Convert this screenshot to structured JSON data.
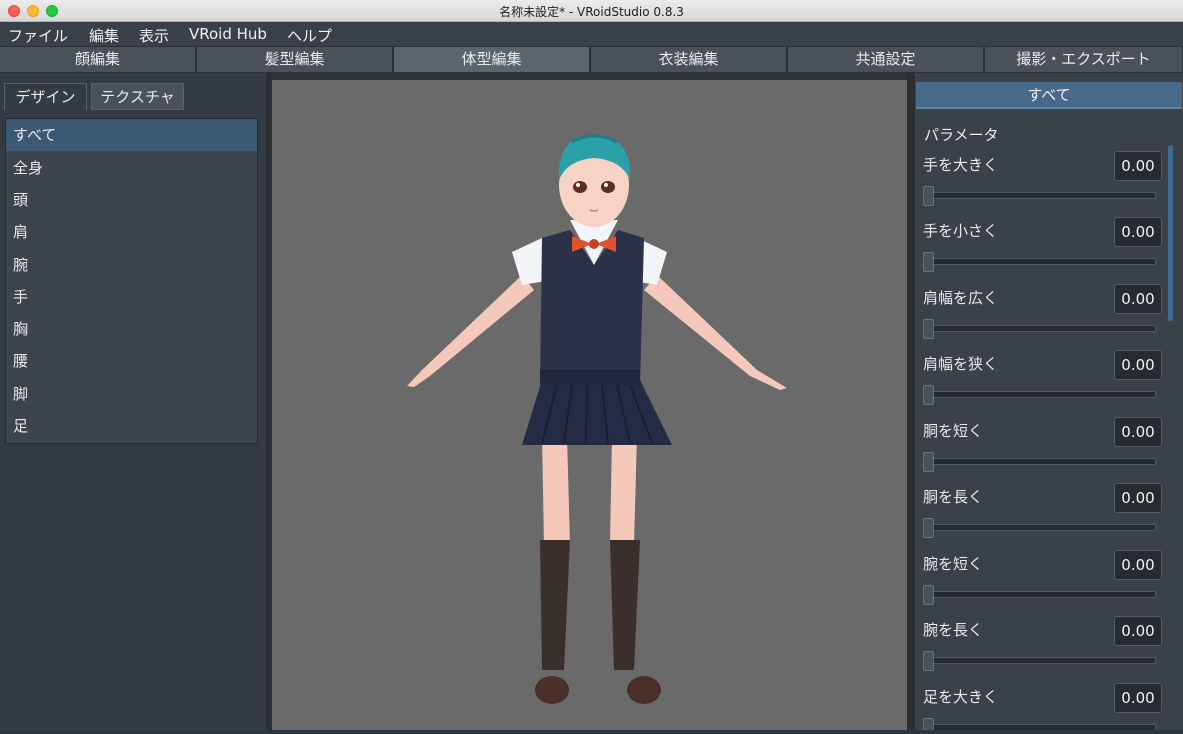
{
  "window": {
    "title": "名称未設定* - VRoidStudio 0.8.3"
  },
  "menu": [
    "ファイル",
    "編集",
    "表示",
    "VRoid Hub",
    "ヘルプ"
  ],
  "main_tabs": [
    "顔編集",
    "髪型編集",
    "体型編集",
    "衣装編集",
    "共通設定",
    "撮影・エクスポート"
  ],
  "active_main_tab": "体型編集",
  "left_panel": {
    "tabs": [
      "デザイン",
      "テクスチャ"
    ],
    "active_tab": "デザイン",
    "items": [
      "すべて",
      "全身",
      "頭",
      "肩",
      "腕",
      "手",
      "胸",
      "腰",
      "脚",
      "足"
    ],
    "selected_item": "すべて"
  },
  "right_panel": {
    "tab": "すべて",
    "section_title": "パラメータ",
    "params": [
      {
        "label": "手を大きく",
        "value": "0.00",
        "level": 0
      },
      {
        "label": "手を小さく",
        "value": "0.00",
        "level": 0
      },
      {
        "label": "肩幅を広く",
        "value": "0.00",
        "level": 0
      },
      {
        "label": "肩幅を狭く",
        "value": "0.00",
        "level": 0
      },
      {
        "label": "胴を短く",
        "value": "0.00",
        "level": 0
      },
      {
        "label": "胴を長く",
        "value": "0.00",
        "level": 0
      },
      {
        "label": "腕を短く",
        "value": "0.00",
        "level": 0
      },
      {
        "label": "腕を長く",
        "value": "0.00",
        "level": 0
      },
      {
        "label": "足を大きく",
        "value": "0.00",
        "level": 0
      }
    ]
  },
  "colors": {
    "accent": "#48698a",
    "selected_item": "#3c5a73",
    "viewport_bg": "#6a6a6a"
  }
}
